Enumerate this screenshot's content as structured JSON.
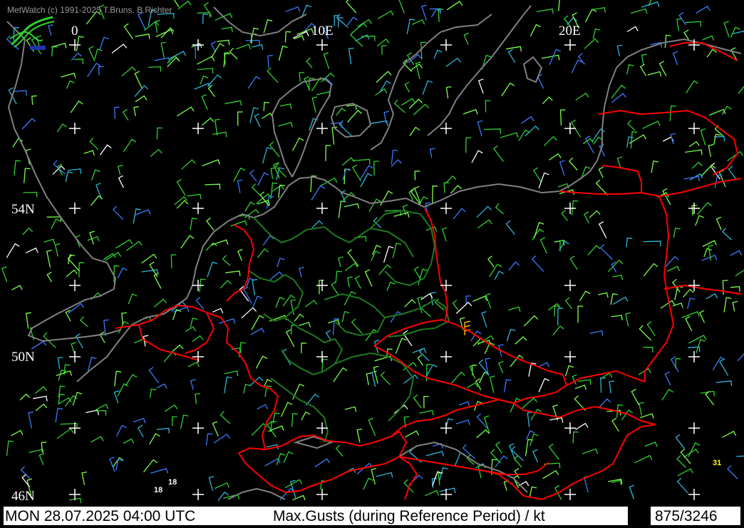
{
  "copyright": "MetWatch  (c) 1991-2025 T.Bruns, B.Richter",
  "longitude_labels": [
    "0",
    "10E",
    "20E"
  ],
  "latitude_labels": [
    "54N",
    "50N",
    "46N"
  ],
  "gust_labels": [
    {
      "value": "18",
      "color": "#ffffff"
    },
    {
      "value": "18",
      "color": "#ffffff"
    },
    {
      "value": "31",
      "color": "#ffff00"
    }
  ],
  "status": {
    "datetime": "MON 28.07.2025 04:00 UTC",
    "parameter": "Max.Gusts (during Reference Period) / kt",
    "count": "875/3246"
  },
  "colors": {
    "background": "#000000",
    "coastline": "#808080",
    "country_border": "#ff0000",
    "state_border": "#1e7a1e",
    "grid_cross": "#ffffff",
    "barb_green": "#2fd12f",
    "barb_lightgreen": "#7cff4a",
    "barb_blue": "#3a7bff",
    "barb_cyan": "#2fb7d9",
    "barb_white": "#ffffff",
    "barb_orange": "#ffa500",
    "label_yellow": "#ffff00"
  },
  "icons": {
    "logo": "metwatch-logo-icon",
    "grid": "plus-cross-icon",
    "barb": "wind-barb-icon"
  }
}
